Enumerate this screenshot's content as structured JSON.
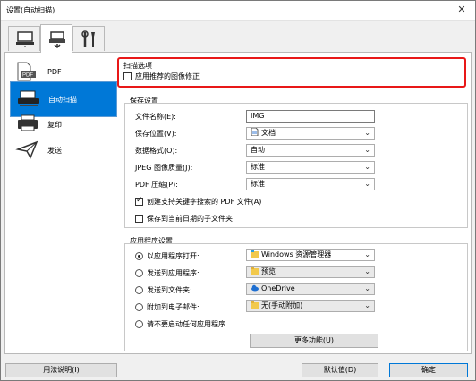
{
  "window": {
    "title": "设置(自动扫描)",
    "close_symbol": "✕"
  },
  "tabs": [
    {
      "name": "scan-from-computer",
      "icon": "computer-icon"
    },
    {
      "name": "scan-from-panel",
      "icon": "scanner-arrow-icon"
    },
    {
      "name": "general-settings",
      "icon": "tools-icon"
    }
  ],
  "sidebar": {
    "items": [
      {
        "label": "PDF",
        "icon": "pdf-document-icon"
      },
      {
        "label": "自动扫描",
        "icon": "scanner-icon"
      },
      {
        "label": "复印",
        "icon": "printer-icon"
      },
      {
        "label": "发送",
        "icon": "send-icon"
      }
    ]
  },
  "scan_options": {
    "title": "扫描选项",
    "apply_correction_label": "应用推荐的图像修正"
  },
  "save_settings": {
    "title": "保存设置",
    "file_name_label": "文件名称(E):",
    "file_name_value": "IMG",
    "save_in_label": "保存位置(V):",
    "save_in_value": "文档",
    "data_format_label": "数据格式(O):",
    "data_format_value": "自动",
    "jpeg_quality_label": "JPEG 图像质量(J):",
    "jpeg_quality_value": "标准",
    "pdf_compression_label": "PDF 压缩(P):",
    "pdf_compression_value": "标准",
    "searchable_pdf_label": "创建支持关键字搜索的 PDF 文件(A)",
    "subfolder_label": "保存到当前日期的子文件夹"
  },
  "app_settings": {
    "title": "应用程序设置",
    "open_with_label": "以应用程序打开:",
    "open_with_value": "Windows 资源管理器",
    "send_to_app_label": "发送到应用程序:",
    "send_to_app_value": "预览",
    "send_to_folder_label": "发送到文件夹:",
    "send_to_folder_value": "OneDrive",
    "attach_email_label": "附加到电子邮件:",
    "attach_email_value": "无(手动附加)",
    "do_not_start_label": "请不要启动任何应用程序",
    "more_functions_label": "更多功能(U)"
  },
  "footer": {
    "instructions_label": "用法说明(I)",
    "defaults_label": "默认值(D)",
    "ok_label": "确定"
  }
}
